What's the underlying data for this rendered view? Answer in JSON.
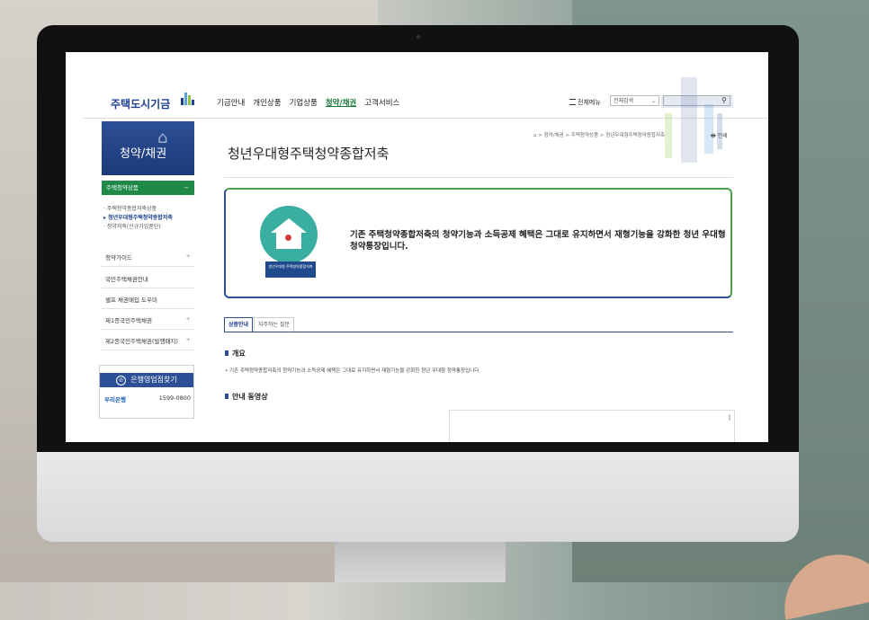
{
  "header": {
    "logo_text": "주택도시기금",
    "nav": [
      "기금안내",
      "개인상품",
      "기업상품",
      "청약/채권",
      "고객서비스"
    ],
    "active_nav": "청약/채권",
    "all_menu": "전체메뉴",
    "search_select": "전체검색"
  },
  "sidebar": {
    "title": "청약/채권",
    "active_section": "주택청약상품",
    "sub_items": [
      "주택청약종합저축상품",
      "청년우대형주택청약종합저축",
      "청약저축(신규가입중단)"
    ],
    "current_sub": "청년우대형주택청약종합저축",
    "items": [
      {
        "label": "청약가이드",
        "expand": "+"
      },
      {
        "label": "국민주택채권안내",
        "expand": ""
      },
      {
        "label": "셀프 채권매입 도우미",
        "expand": ""
      },
      {
        "label": "제1종국민주택채권",
        "expand": "+"
      },
      {
        "label": "제2종국민주택채권(발행패지)",
        "expand": "+"
      }
    ],
    "bank_box": {
      "title": "은행영업점찾기",
      "bank": "우리은행",
      "tel": "1599-0800"
    }
  },
  "content": {
    "breadcrumb": "⌂ > 청약/채권 > 주택청약상품 > 청년우대형주택청약종합저축",
    "print": "🖶 인쇄",
    "page_title": "청년우대형주택청약종합저축",
    "hero_text": "기존 주택청약종합저축의 청약기능과 소득공제 혜택은 그대로 유지하면서 재형기능을 강화한 청년 우대형 청약통장입니다.",
    "hero_badge": "청년우대형 주택청약종합저축",
    "tabs": [
      "상품안내",
      "자주하는 질문"
    ],
    "active_tab": "상품안내",
    "section1_title": "개요",
    "section1_desc": "• 기존 주택청약종합저축의 청약기능과 소득공제 혜택은 그대로 유지하면서 재형기능을 강화한 청년 우대형 청약통장입니다.",
    "section2_title": "안내 동영상"
  },
  "colors": {
    "brand_blue": "#2d4f96",
    "brand_green": "#1f8a47"
  }
}
